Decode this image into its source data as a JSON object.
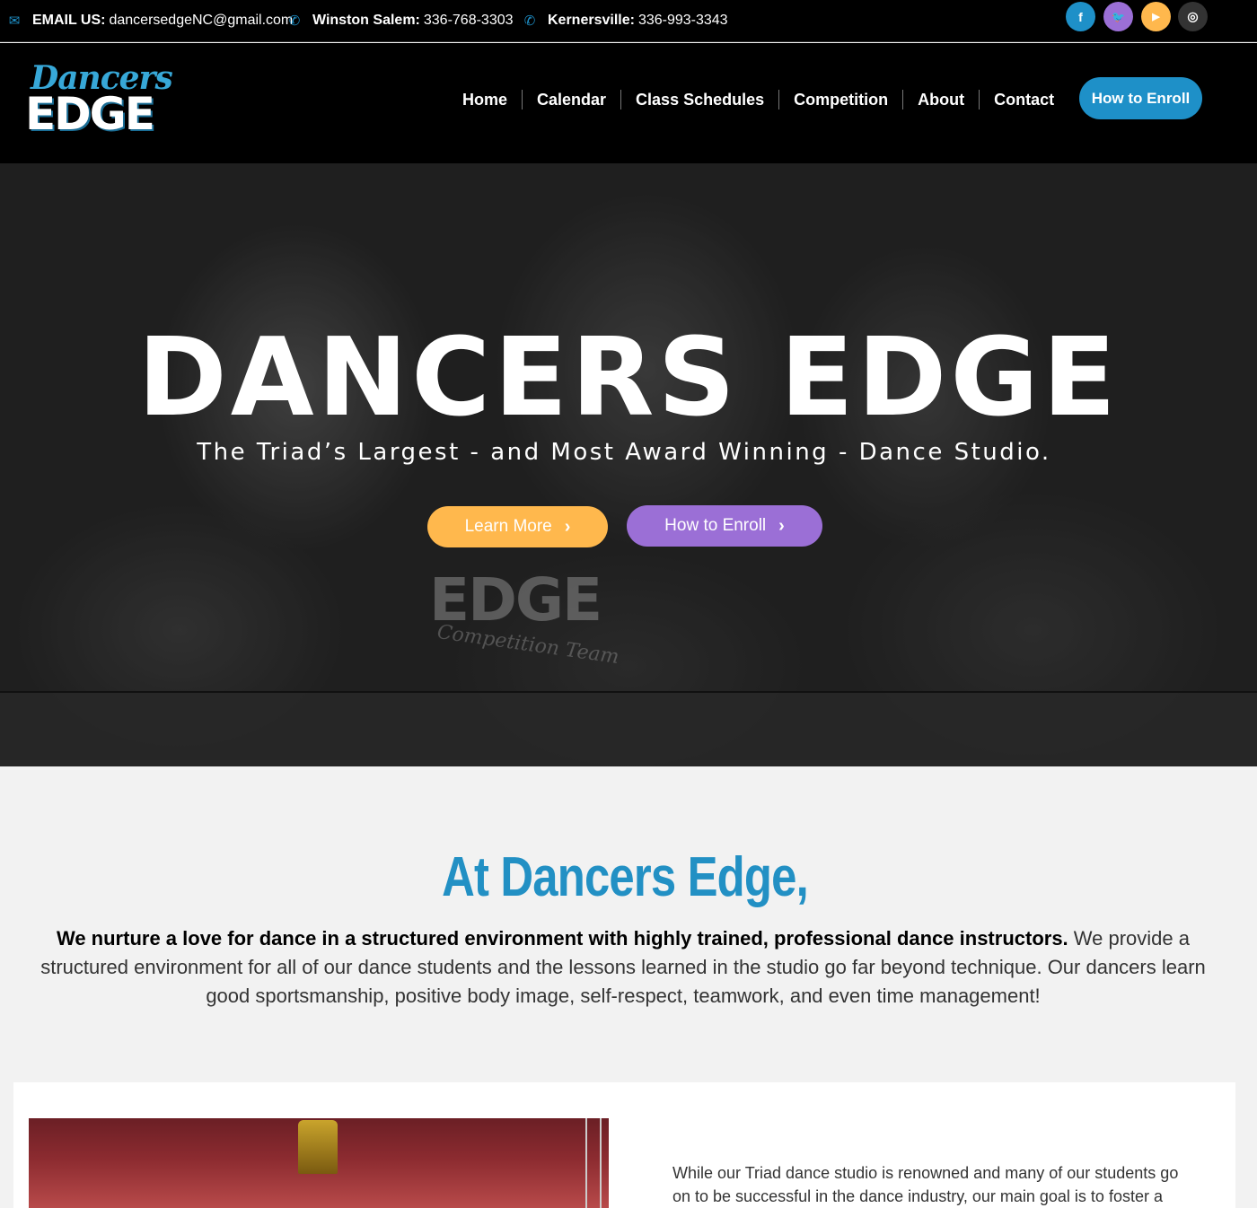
{
  "topbar": {
    "email_label": "EMAIL US:",
    "email_value": "dancersedgeNC@gmail.com",
    "ws_label": "Winston Salem:",
    "ws_phone": "336-768-3303",
    "k_label": "Kernersville:",
    "k_phone": "336-993-3343",
    "social": [
      {
        "icon": "facebook-icon",
        "glyph": "f",
        "color": "#1e90c8"
      },
      {
        "icon": "twitter-icon",
        "glyph": "🐦",
        "color": "#9b6fd6"
      },
      {
        "icon": "youtube-icon",
        "glyph": "▶",
        "color": "#ffb84d"
      },
      {
        "icon": "instagram-icon",
        "glyph": "◎",
        "color": "#333333"
      }
    ]
  },
  "logo": {
    "top": "Dancers",
    "bottom": "EDGE"
  },
  "nav": {
    "items": [
      "Home",
      "Calendar",
      "Class Schedules",
      "Competition",
      "About",
      "Contact"
    ],
    "cta": "How to Enroll"
  },
  "hero": {
    "title": "DANCERS EDGE",
    "subtitle": "The Triad’s Largest - and Most Award Winning - Dance Studio.",
    "learn_more": "Learn More",
    "how_to_enroll": "How to Enroll",
    "photo_text_edge": "EDGE",
    "photo_text_team": "Competition Team"
  },
  "intro": {
    "heading": "At Dancers Edge,",
    "bold_text": "We nurture a love for dance in a structured environment with highly trained, professional dance instructors.",
    "text": " We provide a structured environment for all of our dance students and the lessons learned in the studio go far beyond technique. Our dancers learn good sportsmanship, positive body image, self-respect, teamwork, and even time management!"
  },
  "card": {
    "text": "While our Triad dance studio is renowned and many of our students go on to be successful in the dance industry, our main goal is to foster a"
  },
  "colors": {
    "brand_blue": "#1e90c8",
    "orange": "#ffb84d",
    "purple": "#9b6fd6"
  }
}
